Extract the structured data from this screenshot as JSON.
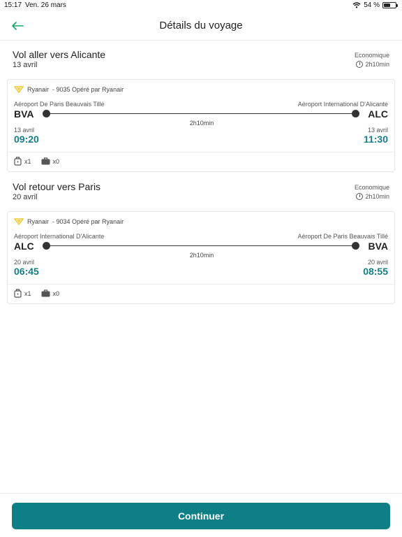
{
  "status_bar": {
    "time": "15:17",
    "date": "Ven. 26 mars",
    "battery": "54 %",
    "battery_level": 0.54
  },
  "header": {
    "title": "Détails du voyage",
    "back_icon": "arrow-left-icon"
  },
  "outbound": {
    "destination": "Vol aller vers Alicante",
    "date": "13 avril",
    "cabin_class": "Economique",
    "duration": "2h10min",
    "flight": {
      "airline": "Ryanair",
      "flight_info": "- 9035 Opéré par Ryanair",
      "from_airport": "Aéroport De Paris Beauvais Tillé",
      "to_airport": "Aéroport International D'Alicante",
      "from_code": "BVA",
      "to_code": "ALC",
      "duration": "2h10min",
      "from_date": "13 avril",
      "to_date": "13 avril",
      "from_time": "09:20",
      "to_time": "11:30",
      "cabin_bags": "x1",
      "checked_bags": "x0"
    }
  },
  "return": {
    "destination": "Vol retour vers Paris",
    "date": "20 avril",
    "cabin_class": "Economique",
    "duration": "2h10min",
    "flight": {
      "airline": "Ryanair",
      "flight_info": "- 9034 Opéré par Ryanair",
      "from_airport": "Aéroport International D'Alicante",
      "to_airport": "Aéroport De Paris Beauvais Tillé",
      "from_code": "ALC",
      "to_code": "BVA",
      "duration": "2h10min",
      "from_date": "20 avril",
      "to_date": "20 avril",
      "from_time": "06:45",
      "to_time": "08:55",
      "cabin_bags": "x1",
      "checked_bags": "x0"
    }
  },
  "footer": {
    "continue_label": "Continuer"
  },
  "colors": {
    "accent": "#0e7f87",
    "time_text": "#137e87",
    "back_arrow": "#1aa56a",
    "ryanair_yellow": "#f1c933"
  }
}
